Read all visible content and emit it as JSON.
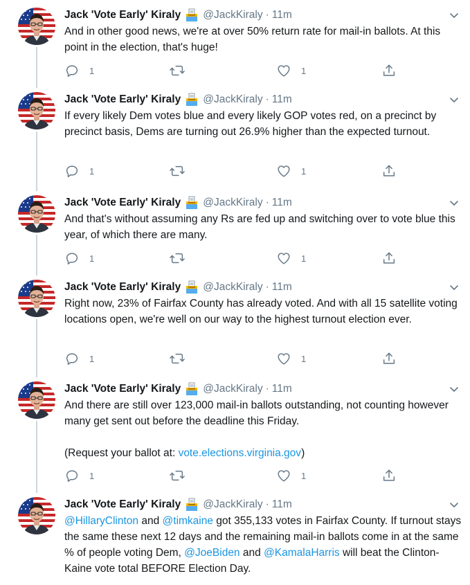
{
  "tweets": [
    {
      "name": "Jack 'Vote Early' Kiraly",
      "badge_icon": "ballot-box-icon",
      "handle": "@JackKiraly",
      "separator": "·",
      "time": "11m",
      "paragraphs": [
        [
          {
            "text": "And in other good news, we're at over 50% return rate for mail-in ballots. At this point in the election, that's huge!"
          }
        ]
      ],
      "replies": "1",
      "retweets": "",
      "likes": "1"
    },
    {
      "name": "Jack 'Vote Early' Kiraly",
      "badge_icon": "ballot-box-icon",
      "handle": "@JackKiraly",
      "separator": "·",
      "time": "11m",
      "paragraphs": [
        [
          {
            "text": "If every likely Dem votes blue and every likely GOP votes red, on a precinct by precinct basis, Dems are turning out 26.9% higher than the expected turnout."
          }
        ]
      ],
      "replies": "1",
      "retweets": "",
      "likes": "1"
    },
    {
      "name": "Jack 'Vote Early' Kiraly",
      "badge_icon": "ballot-box-icon",
      "handle": "@JackKiraly",
      "separator": "·",
      "time": "11m",
      "paragraphs": [
        [
          {
            "text": "And that's without assuming any Rs are fed up and switching over to vote blue this year, of which there are many."
          }
        ]
      ],
      "replies": "1",
      "retweets": "",
      "likes": "1"
    },
    {
      "name": "Jack 'Vote Early' Kiraly",
      "badge_icon": "ballot-box-icon",
      "handle": "@JackKiraly",
      "separator": "·",
      "time": "11m",
      "paragraphs": [
        [
          {
            "text": "Right now, 23% of Fairfax County has already voted. And with all 15 satellite voting locations open, we're well on our way to the highest turnout election ever."
          }
        ]
      ],
      "replies": "1",
      "retweets": "",
      "likes": "1"
    },
    {
      "name": "Jack 'Vote Early' Kiraly",
      "badge_icon": "ballot-box-icon",
      "handle": "@JackKiraly",
      "separator": "·",
      "time": "11m",
      "paragraphs": [
        [
          {
            "text": "And there are still over 123,000 mail-in ballots outstanding, not counting however many get sent out before the deadline this Friday."
          }
        ],
        [
          {
            "text": "(Request your ballot at: "
          },
          {
            "text": "vote.elections.virginia.gov",
            "link": true
          },
          {
            "text": ")"
          }
        ]
      ],
      "replies": "1",
      "retweets": "",
      "likes": "1"
    },
    {
      "name": "Jack 'Vote Early' Kiraly",
      "badge_icon": "ballot-box-icon",
      "handle": "@JackKiraly",
      "separator": "·",
      "time": "11m",
      "paragraphs": [
        [
          {
            "text": "@HillaryClinton",
            "link": true
          },
          {
            "text": " and "
          },
          {
            "text": "@timkaine",
            "link": true
          },
          {
            "text": " got 355,133 votes in Fairfax County. If turnout stays the same these next 12 days and the remaining mail-in ballots come in at the same % of people voting Dem, "
          },
          {
            "text": "@JoeBiden",
            "link": true
          },
          {
            "text": " and "
          },
          {
            "text": "@KamalaHarris",
            "link": true
          },
          {
            "text": " will beat the Clinton-Kaine vote total BEFORE Election Day."
          }
        ]
      ],
      "replies": "",
      "retweets": "",
      "likes": ""
    }
  ],
  "colors": {
    "text": "#14171a",
    "secondary": "#657786",
    "link": "#1b95e0",
    "thread_line": "#ccd6dd"
  }
}
